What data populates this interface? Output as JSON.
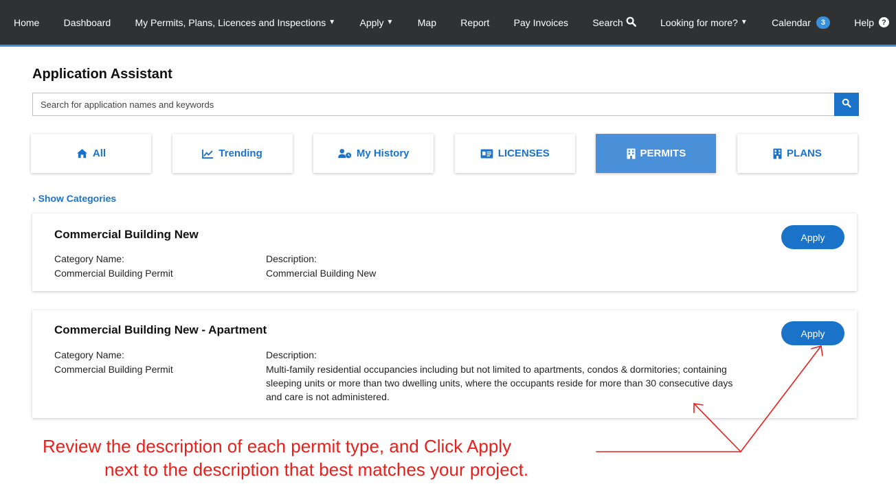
{
  "nav": {
    "items": [
      {
        "label": "Home",
        "caret": false
      },
      {
        "label": "Dashboard",
        "caret": false
      },
      {
        "label": "My Permits, Plans, Licences and Inspections",
        "caret": true
      },
      {
        "label": "Apply",
        "caret": true
      },
      {
        "label": "Map",
        "caret": false
      },
      {
        "label": "Report",
        "caret": false
      },
      {
        "label": "Pay Invoices",
        "caret": false
      },
      {
        "label": "Search",
        "caret": false
      },
      {
        "label": "Looking for more?",
        "caret": true
      },
      {
        "label": "Calendar",
        "caret": false
      },
      {
        "label": "Help",
        "caret": false
      }
    ],
    "calendar_badge": "3",
    "search_icon": "search-icon",
    "help_icon": "question-circle-icon"
  },
  "page": {
    "title": "Application Assistant"
  },
  "search": {
    "placeholder": "Search for application names and keywords",
    "value": ""
  },
  "tabs": [
    {
      "label": "All",
      "icon": "home-icon",
      "active": false
    },
    {
      "label": "Trending",
      "icon": "trend-chart-icon",
      "active": false
    },
    {
      "label": "My History",
      "icon": "user-history-icon",
      "active": false
    },
    {
      "label": "LICENSES",
      "icon": "id-card-icon",
      "active": false
    },
    {
      "label": "PERMITS",
      "icon": "building-icon",
      "active": true
    },
    {
      "label": "PLANS",
      "icon": "building-icon",
      "active": false
    }
  ],
  "show_categories": "Show Categories",
  "cards": [
    {
      "title": "Commercial Building New",
      "category_label": "Category Name:",
      "category_value": "Commercial Building Permit",
      "description_label": "Description:",
      "description_lines": [
        "Commercial Building New"
      ],
      "apply_label": "Apply"
    },
    {
      "title": "Commercial Building New - Apartment",
      "category_label": "Category Name:",
      "category_value": "Commercial Building Permit",
      "description_label": "Description:",
      "description_lines": [
        "Multi-family residential occupancies including but not limited to apartments, condos & dormitories; containing",
        "sleeping units or more than two dwelling units, where the occupants reside for more than 30 consecutive days",
        "and care is not administered."
      ],
      "apply_label": "Apply"
    }
  ],
  "annotation": {
    "line1": "Review the description of each permit type, and Click Apply",
    "line2": "next to the description that best matches your project.",
    "color": "#e8201c"
  },
  "colors": {
    "nav_bg": "#2f3133",
    "accent": "#1a73c9",
    "active_tab": "#4a90d9"
  }
}
